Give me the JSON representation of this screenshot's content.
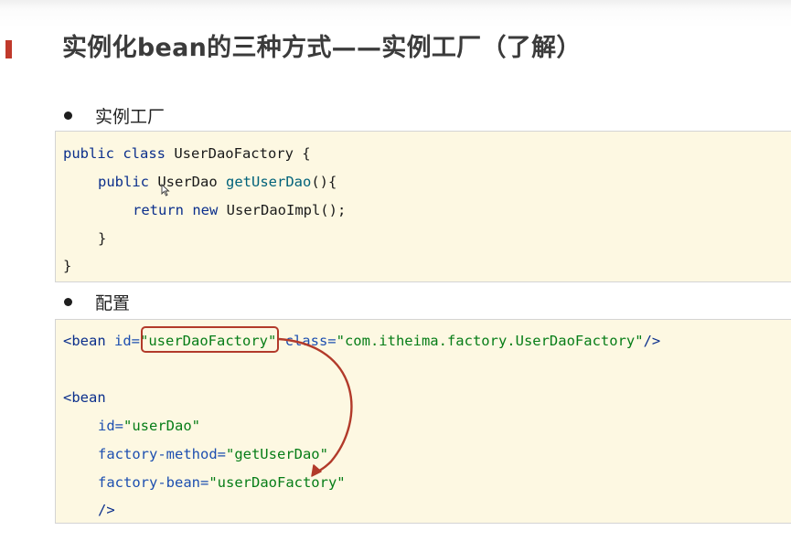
{
  "slide": {
    "title": "实例化bean的三种方式——实例工厂（了解）"
  },
  "section1": {
    "bullet": "实例工厂",
    "code": {
      "l1_kw": "public class",
      "l1_name": " UserDaoFactory {",
      "l2_kw": "public",
      "l2_type": " UserDao ",
      "l2_method": "getUserDao",
      "l2_rest": "(){",
      "l3_kw": "return new",
      "l3_rest": " UserDaoImpl();",
      "l4": "}",
      "l5": "}"
    }
  },
  "section2": {
    "bullet": "配置",
    "code": {
      "b1_tag": "<bean",
      "b1_attr1": " id=",
      "b1_val1": "\"userDaoFactory\"",
      "b1_attr2": " class=",
      "b1_val2": "\"com.itheima.factory.UserDaoFactory\"",
      "b1_end": "/>",
      "b2_tag": "<bean",
      "b3_attr": "id=",
      "b3_val": "\"userDao\"",
      "b4_attr": "factory-method=",
      "b4_val": "\"getUserDao\"",
      "b5_attr": "factory-bean=",
      "b5_val": "\"userDaoFactory\"",
      "b6_end": "/>"
    }
  },
  "colors": {
    "accent": "#c0392b",
    "code_background": "#fdf8e2",
    "annotation": "#b23a2a",
    "keyword": "#0b2f8c",
    "string": "#067d17"
  },
  "icons": {
    "cursor": "mouse-pointer-icon",
    "arrow": "curved-arrow-icon"
  }
}
